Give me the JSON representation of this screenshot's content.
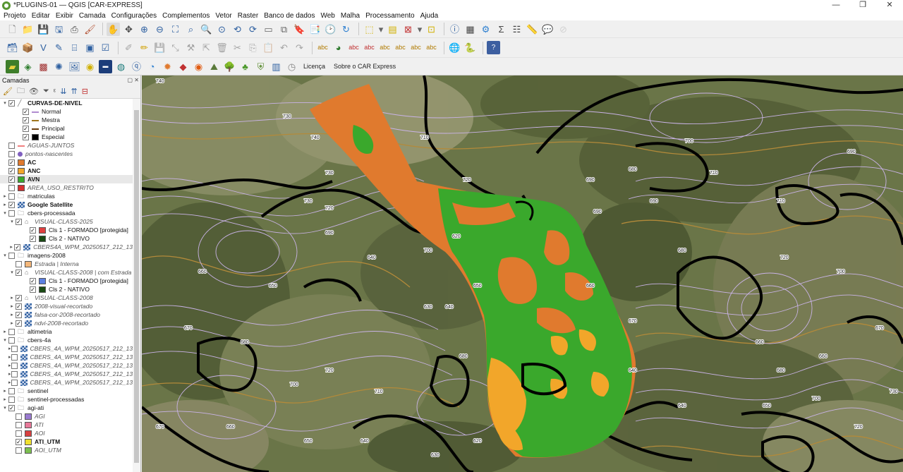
{
  "window": {
    "title": "*PLUGINS-01 — QGIS [CAR-EXPRESS]",
    "controls": [
      "—",
      "❐",
      "✕"
    ]
  },
  "menu": [
    "Projeto",
    "Editar",
    "Exibir",
    "Camada",
    "Configurações",
    "Complementos",
    "Vetor",
    "Raster",
    "Banco de dados",
    "Web",
    "Malha",
    "Processamento",
    "Ajuda"
  ],
  "toolbar3": {
    "licenca": "Licença",
    "sobre": "Sobre o CAR Express"
  },
  "panel": {
    "title": "Camadas",
    "ctrls": "▢ ✕"
  },
  "layers": [
    {
      "indent": 0,
      "arrow": "▾",
      "checked": true,
      "sym": "line-multi",
      "label": "CURVAS-DE-NIVEL",
      "style": "b"
    },
    {
      "indent": 2,
      "arrow": "",
      "checked": true,
      "sym": "line:#b08cd0",
      "label": "Normal",
      "style": ""
    },
    {
      "indent": 2,
      "arrow": "",
      "checked": true,
      "sym": "line:#a0761e",
      "label": "Mestra",
      "style": ""
    },
    {
      "indent": 2,
      "arrow": "",
      "checked": true,
      "sym": "line:#6a3c0c",
      "label": "Principal",
      "style": ""
    },
    {
      "indent": 2,
      "arrow": "",
      "checked": true,
      "sym": "fill:#000000",
      "label": "Especial",
      "style": ""
    },
    {
      "indent": 0,
      "arrow": "",
      "checked": false,
      "sym": "line:#f08080",
      "label": "AGUAS-JUNTOS",
      "style": "it"
    },
    {
      "indent": 0,
      "arrow": "",
      "checked": false,
      "sym": "dot:#8060c0",
      "label": "pontos-nascentes",
      "style": "it"
    },
    {
      "indent": 0,
      "arrow": "",
      "checked": true,
      "sym": "fill:#e07a2e",
      "label": "AC",
      "style": "b"
    },
    {
      "indent": 0,
      "arrow": "",
      "checked": true,
      "sym": "fill:#f2a62a",
      "label": "ANC",
      "style": "b"
    },
    {
      "indent": 0,
      "arrow": "",
      "checked": true,
      "sym": "fill:#3aa82c",
      "label": "AVN",
      "style": "b",
      "selected": true
    },
    {
      "indent": 0,
      "arrow": "",
      "checked": false,
      "sym": "fill:#d83030",
      "label": "AREA_USO_RESTRITO",
      "style": "it"
    },
    {
      "indent": 0,
      "arrow": "▸",
      "checked": false,
      "sym": "group",
      "label": "matriculas",
      "style": ""
    },
    {
      "indent": 0,
      "arrow": "▸",
      "checked": true,
      "sym": "raster",
      "label": "Google Satellite",
      "style": "b"
    },
    {
      "indent": 0,
      "arrow": "▾",
      "checked": false,
      "sym": "group",
      "label": "cbers-processada",
      "style": ""
    },
    {
      "indent": 1,
      "arrow": "▾",
      "checked": true,
      "sym": "vgroup",
      "label": "VISUAL-CLASS-2025",
      "style": "it"
    },
    {
      "indent": 3,
      "arrow": "",
      "checked": true,
      "sym": "fill:#e04040",
      "label": "Cls 1 - FORMADO [protegida]",
      "style": ""
    },
    {
      "indent": 3,
      "arrow": "",
      "checked": true,
      "sym": "fill:#1a4a14",
      "label": "Cls 2 - NATIVO",
      "style": ""
    },
    {
      "indent": 1,
      "arrow": "▸",
      "checked": true,
      "sym": "raster",
      "label": "CBERS4A_WPM_20250517_212_13",
      "style": "it"
    },
    {
      "indent": 0,
      "arrow": "▾",
      "checked": false,
      "sym": "group",
      "label": "imagens-2008",
      "style": ""
    },
    {
      "indent": 1,
      "arrow": "",
      "checked": false,
      "sym": "fill:#f4b77a",
      "label": "Estrada | Interna",
      "style": "it"
    },
    {
      "indent": 1,
      "arrow": "▾",
      "checked": true,
      "sym": "vgroup",
      "label": "VISUAL-CLASS-2008 | com Estrada",
      "style": "it"
    },
    {
      "indent": 3,
      "arrow": "",
      "checked": true,
      "sym": "fill:#5b7fe0",
      "label": "Cls 1 - FORMADO [protegida]",
      "style": ""
    },
    {
      "indent": 3,
      "arrow": "",
      "checked": true,
      "sym": "fill:#1a4a14",
      "label": "Cls 2 - NATIVO",
      "style": ""
    },
    {
      "indent": 1,
      "arrow": "▸",
      "checked": true,
      "sym": "vgroup",
      "label": "VISUAL-CLASS-2008",
      "style": "it"
    },
    {
      "indent": 1,
      "arrow": "▸",
      "checked": true,
      "sym": "raster",
      "label": "2008-visual-recortado",
      "style": "it"
    },
    {
      "indent": 1,
      "arrow": "▸",
      "checked": true,
      "sym": "raster",
      "label": "falsa-cor-2008-recortado",
      "style": "it"
    },
    {
      "indent": 1,
      "arrow": "▸",
      "checked": true,
      "sym": "raster",
      "label": "ndvi-2008-recortado",
      "style": "it"
    },
    {
      "indent": 0,
      "arrow": "▸",
      "checked": false,
      "sym": "group",
      "label": "altimetria",
      "style": ""
    },
    {
      "indent": 0,
      "arrow": "▾",
      "checked": false,
      "sym": "group",
      "label": "cbers-4a",
      "style": ""
    },
    {
      "indent": 1,
      "arrow": "▸",
      "checked": false,
      "sym": "raster",
      "label": "CBERS_4A_WPM_20250517_212_13",
      "style": "it"
    },
    {
      "indent": 1,
      "arrow": "▸",
      "checked": false,
      "sym": "raster",
      "label": "CBERS_4A_WPM_20250517_212_13",
      "style": "it"
    },
    {
      "indent": 1,
      "arrow": "▸",
      "checked": false,
      "sym": "raster",
      "label": "CBERS_4A_WPM_20250517_212_13",
      "style": "it"
    },
    {
      "indent": 1,
      "arrow": "▸",
      "checked": false,
      "sym": "raster",
      "label": "CBERS_4A_WPM_20250517_212_13",
      "style": "it"
    },
    {
      "indent": 1,
      "arrow": "▸",
      "checked": false,
      "sym": "raster",
      "label": "CBERS_4A_WPM_20250517_212_13",
      "style": "it"
    },
    {
      "indent": 0,
      "arrow": "▸",
      "checked": false,
      "sym": "group",
      "label": "sentinel",
      "style": ""
    },
    {
      "indent": 0,
      "arrow": "▸",
      "checked": false,
      "sym": "group",
      "label": "sentinel-processadas",
      "style": ""
    },
    {
      "indent": 0,
      "arrow": "▾",
      "checked": true,
      "sym": "group",
      "label": "agi-ati",
      "style": ""
    },
    {
      "indent": 1,
      "arrow": "",
      "checked": false,
      "sym": "fill:#9a7ad0",
      "label": "AGI",
      "style": "it"
    },
    {
      "indent": 1,
      "arrow": "",
      "checked": false,
      "sym": "fill:#e8799a",
      "label": "ATI",
      "style": "it"
    },
    {
      "indent": 1,
      "arrow": "",
      "checked": false,
      "sym": "fill:#d84040",
      "label": "AOI",
      "style": "it"
    },
    {
      "indent": 1,
      "arrow": "",
      "checked": true,
      "sym": "fill:#f0e030",
      "label": "ATI_UTM",
      "style": "b"
    },
    {
      "indent": 1,
      "arrow": "",
      "checked": false,
      "sym": "fill:#7cc050",
      "label": "AOI_UTM",
      "style": "it"
    }
  ],
  "map": {
    "contour_labels": [
      "740",
      "730",
      "740",
      "730",
      "720",
      "730",
      "710",
      "720",
      "700",
      "690",
      "690",
      "690",
      "680",
      "690",
      "700",
      "710",
      "710",
      "720",
      "700",
      "690",
      "680",
      "670",
      "660",
      "650",
      "640",
      "630",
      "620",
      "640",
      "650",
      "660",
      "670",
      "680",
      "700",
      "720",
      "710",
      "680",
      "670",
      "660",
      "650",
      "640",
      "630",
      "620",
      "640",
      "660",
      "680",
      "700",
      "720",
      "730",
      "640",
      "650",
      "660",
      "670"
    ]
  }
}
